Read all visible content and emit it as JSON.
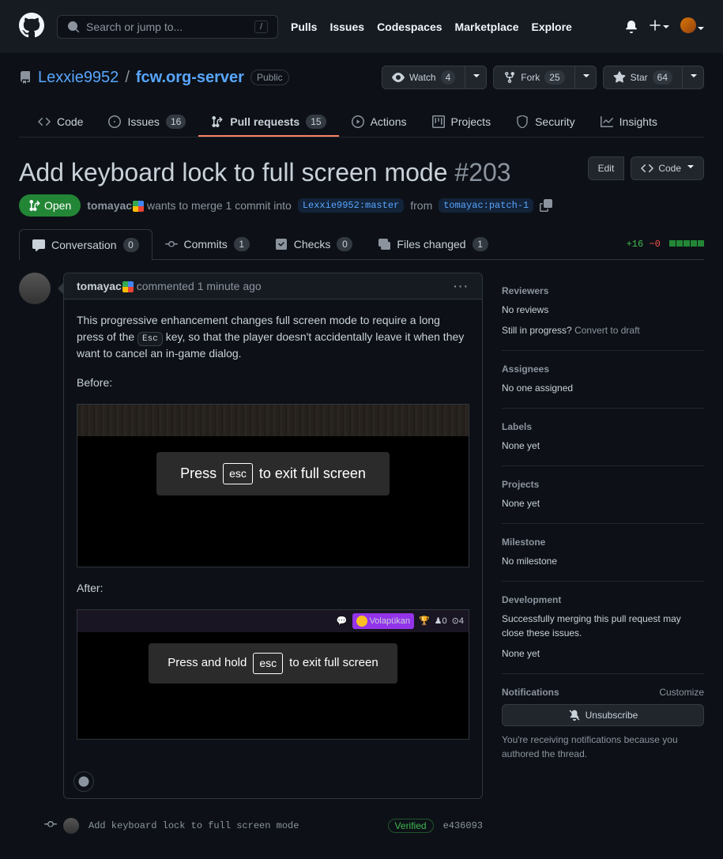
{
  "nav": {
    "search_placeholder": "Search or jump to...",
    "search_key": "/",
    "links": [
      "Pulls",
      "Issues",
      "Codespaces",
      "Marketplace",
      "Explore"
    ]
  },
  "repo": {
    "owner": "Lexxie9952",
    "name": "fcw.org-server",
    "visibility": "Public",
    "watch_label": "Watch",
    "watch_count": "4",
    "fork_label": "Fork",
    "fork_count": "25",
    "star_label": "Star",
    "star_count": "64"
  },
  "tabs": {
    "code": "Code",
    "issues": "Issues",
    "issues_count": "16",
    "pulls": "Pull requests",
    "pulls_count": "15",
    "actions": "Actions",
    "projects": "Projects",
    "security": "Security",
    "insights": "Insights"
  },
  "pr": {
    "title": "Add keyboard lock to full screen mode",
    "number": "#203",
    "edit": "Edit",
    "code_btn": "Code",
    "state": "Open",
    "author": "tomayac",
    "merge_text_1": "wants to merge 1 commit into",
    "base_branch": "Lexxie9952:master",
    "merge_text_2": "from",
    "head_branch": "tomayac:patch-1",
    "diff_add": "+16",
    "diff_del": "−0"
  },
  "subtabs": {
    "conversation": "Conversation",
    "conversation_count": "0",
    "commits": "Commits",
    "commits_count": "1",
    "checks": "Checks",
    "checks_count": "0",
    "files": "Files changed",
    "files_count": "1"
  },
  "comment": {
    "author": "tomayac",
    "time_text": "commented 1 minute ago",
    "body_1_a": "This progressive enhancement changes full screen mode to require a long press of the ",
    "body_1_kbd": "Esc",
    "body_1_b": " key, so that the player doesn't accidentally leave it when they want to cancel an in-game dialog.",
    "before_label": "Before:",
    "after_label": "After:",
    "banner1_a": "Press",
    "banner1_kbd": "esc",
    "banner1_b": "to exit full screen",
    "banner2_a": "Press and hold",
    "banner2_kbd": "esc",
    "banner2_b": "to exit full screen",
    "volapukan": "Volapükan",
    "stat0": "0",
    "stat4": "4"
  },
  "commit": {
    "message": "Add keyboard lock to full screen mode",
    "verified": "Verified",
    "sha": "e436093"
  },
  "sidebar": {
    "reviewers_title": "Reviewers",
    "reviewers_none": "No reviews",
    "draft_q": "Still in progress?",
    "draft_link": "Convert to draft",
    "assignees_title": "Assignees",
    "assignees_none": "No one assigned",
    "labels_title": "Labels",
    "labels_none": "None yet",
    "projects_title": "Projects",
    "projects_none": "None yet",
    "milestone_title": "Milestone",
    "milestone_none": "No milestone",
    "dev_title": "Development",
    "dev_text": "Successfully merging this pull request may close these issues.",
    "dev_none": "None yet",
    "notif_title": "Notifications",
    "customize": "Customize",
    "unsubscribe": "Unsubscribe",
    "notif_reason": "You're receiving notifications because you authored the thread."
  }
}
